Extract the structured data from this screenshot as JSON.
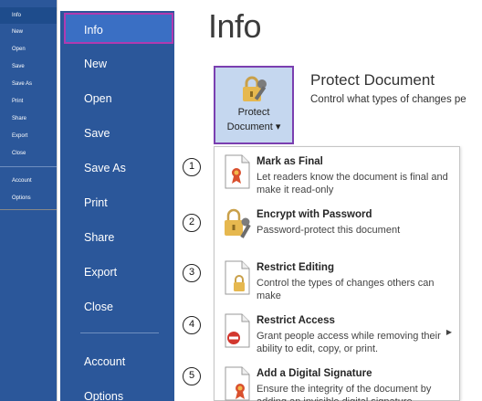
{
  "back_sidebar": {
    "items": [
      {
        "label": "Info"
      },
      {
        "label": "New"
      },
      {
        "label": "Open"
      },
      {
        "label": "Save"
      },
      {
        "label": "Save As"
      },
      {
        "label": "Print"
      },
      {
        "label": "Share"
      },
      {
        "label": "Export"
      },
      {
        "label": "Close"
      },
      {
        "label": "Account"
      },
      {
        "label": "Options"
      }
    ]
  },
  "sidebar": {
    "items": [
      {
        "label": "Info"
      },
      {
        "label": "New"
      },
      {
        "label": "Open"
      },
      {
        "label": "Save"
      },
      {
        "label": "Save As"
      },
      {
        "label": "Print"
      },
      {
        "label": "Share"
      },
      {
        "label": "Export"
      },
      {
        "label": "Close"
      },
      {
        "label": "Account"
      },
      {
        "label": "Options"
      }
    ]
  },
  "page": {
    "title": "Info"
  },
  "protect": {
    "button_line1": "Protect",
    "button_line2": "Document ▾",
    "title": "Protect Document",
    "description": "Control what types of changes pe"
  },
  "menu": {
    "items": [
      {
        "title": "Mark as Final",
        "desc": "Let readers know the document is final and make it read-only",
        "icon": "final-ribbon-icon"
      },
      {
        "title": "Encrypt with Password",
        "desc": "Password-protect this document",
        "icon": "lock-key-icon"
      },
      {
        "title": "Restrict Editing",
        "desc": "Control the types of changes others can make",
        "icon": "restrict-lock-icon"
      },
      {
        "title": "Restrict Access",
        "desc": "Grant people access while removing their ability to edit, copy, or print.",
        "icon": "no-entry-icon"
      },
      {
        "title": "Add a Digital Signature",
        "desc": "Ensure the integrity of the document by adding an invisible digital signature",
        "icon": "signature-ribbon-icon"
      }
    ]
  },
  "callouts": [
    "1",
    "2",
    "3",
    "4",
    "5"
  ],
  "colors": {
    "sidebar": "#2b579a",
    "active": "#3a6fc4",
    "highlight_border": "#b03ab0",
    "protect_bg": "#c5d7ef"
  }
}
